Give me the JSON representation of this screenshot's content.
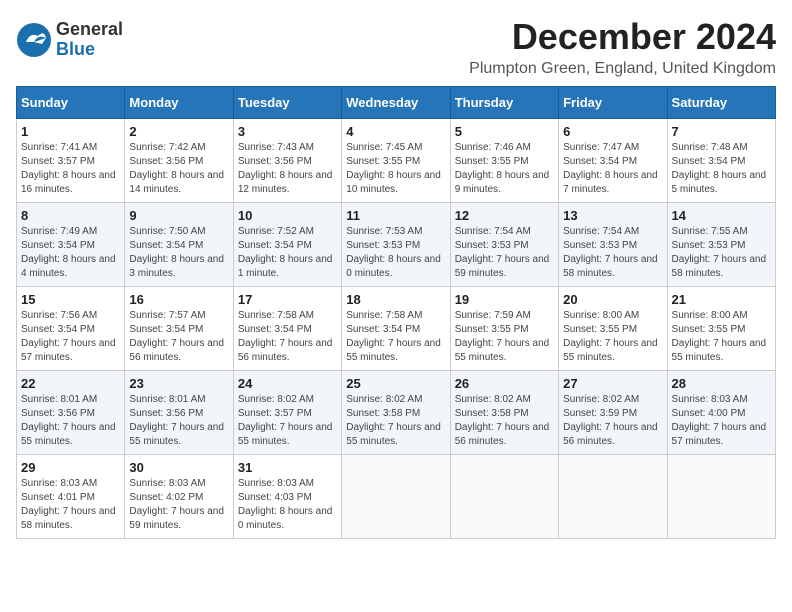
{
  "logo": {
    "line1": "General",
    "line2": "Blue"
  },
  "header": {
    "month_title": "December 2024",
    "subtitle": "Plumpton Green, England, United Kingdom"
  },
  "weekdays": [
    "Sunday",
    "Monday",
    "Tuesday",
    "Wednesday",
    "Thursday",
    "Friday",
    "Saturday"
  ],
  "weeks": [
    [
      {
        "day": "1",
        "rise": "Sunrise: 7:41 AM",
        "set": "Sunset: 3:57 PM",
        "light": "Daylight: 8 hours and 16 minutes."
      },
      {
        "day": "2",
        "rise": "Sunrise: 7:42 AM",
        "set": "Sunset: 3:56 PM",
        "light": "Daylight: 8 hours and 14 minutes."
      },
      {
        "day": "3",
        "rise": "Sunrise: 7:43 AM",
        "set": "Sunset: 3:56 PM",
        "light": "Daylight: 8 hours and 12 minutes."
      },
      {
        "day": "4",
        "rise": "Sunrise: 7:45 AM",
        "set": "Sunset: 3:55 PM",
        "light": "Daylight: 8 hours and 10 minutes."
      },
      {
        "day": "5",
        "rise": "Sunrise: 7:46 AM",
        "set": "Sunset: 3:55 PM",
        "light": "Daylight: 8 hours and 9 minutes."
      },
      {
        "day": "6",
        "rise": "Sunrise: 7:47 AM",
        "set": "Sunset: 3:54 PM",
        "light": "Daylight: 8 hours and 7 minutes."
      },
      {
        "day": "7",
        "rise": "Sunrise: 7:48 AM",
        "set": "Sunset: 3:54 PM",
        "light": "Daylight: 8 hours and 5 minutes."
      }
    ],
    [
      {
        "day": "8",
        "rise": "Sunrise: 7:49 AM",
        "set": "Sunset: 3:54 PM",
        "light": "Daylight: 8 hours and 4 minutes."
      },
      {
        "day": "9",
        "rise": "Sunrise: 7:50 AM",
        "set": "Sunset: 3:54 PM",
        "light": "Daylight: 8 hours and 3 minutes."
      },
      {
        "day": "10",
        "rise": "Sunrise: 7:52 AM",
        "set": "Sunset: 3:54 PM",
        "light": "Daylight: 8 hours and 1 minute."
      },
      {
        "day": "11",
        "rise": "Sunrise: 7:53 AM",
        "set": "Sunset: 3:53 PM",
        "light": "Daylight: 8 hours and 0 minutes."
      },
      {
        "day": "12",
        "rise": "Sunrise: 7:54 AM",
        "set": "Sunset: 3:53 PM",
        "light": "Daylight: 7 hours and 59 minutes."
      },
      {
        "day": "13",
        "rise": "Sunrise: 7:54 AM",
        "set": "Sunset: 3:53 PM",
        "light": "Daylight: 7 hours and 58 minutes."
      },
      {
        "day": "14",
        "rise": "Sunrise: 7:55 AM",
        "set": "Sunset: 3:53 PM",
        "light": "Daylight: 7 hours and 58 minutes."
      }
    ],
    [
      {
        "day": "15",
        "rise": "Sunrise: 7:56 AM",
        "set": "Sunset: 3:54 PM",
        "light": "Daylight: 7 hours and 57 minutes."
      },
      {
        "day": "16",
        "rise": "Sunrise: 7:57 AM",
        "set": "Sunset: 3:54 PM",
        "light": "Daylight: 7 hours and 56 minutes."
      },
      {
        "day": "17",
        "rise": "Sunrise: 7:58 AM",
        "set": "Sunset: 3:54 PM",
        "light": "Daylight: 7 hours and 56 minutes."
      },
      {
        "day": "18",
        "rise": "Sunrise: 7:58 AM",
        "set": "Sunset: 3:54 PM",
        "light": "Daylight: 7 hours and 55 minutes."
      },
      {
        "day": "19",
        "rise": "Sunrise: 7:59 AM",
        "set": "Sunset: 3:55 PM",
        "light": "Daylight: 7 hours and 55 minutes."
      },
      {
        "day": "20",
        "rise": "Sunrise: 8:00 AM",
        "set": "Sunset: 3:55 PM",
        "light": "Daylight: 7 hours and 55 minutes."
      },
      {
        "day": "21",
        "rise": "Sunrise: 8:00 AM",
        "set": "Sunset: 3:55 PM",
        "light": "Daylight: 7 hours and 55 minutes."
      }
    ],
    [
      {
        "day": "22",
        "rise": "Sunrise: 8:01 AM",
        "set": "Sunset: 3:56 PM",
        "light": "Daylight: 7 hours and 55 minutes."
      },
      {
        "day": "23",
        "rise": "Sunrise: 8:01 AM",
        "set": "Sunset: 3:56 PM",
        "light": "Daylight: 7 hours and 55 minutes."
      },
      {
        "day": "24",
        "rise": "Sunrise: 8:02 AM",
        "set": "Sunset: 3:57 PM",
        "light": "Daylight: 7 hours and 55 minutes."
      },
      {
        "day": "25",
        "rise": "Sunrise: 8:02 AM",
        "set": "Sunset: 3:58 PM",
        "light": "Daylight: 7 hours and 55 minutes."
      },
      {
        "day": "26",
        "rise": "Sunrise: 8:02 AM",
        "set": "Sunset: 3:58 PM",
        "light": "Daylight: 7 hours and 56 minutes."
      },
      {
        "day": "27",
        "rise": "Sunrise: 8:02 AM",
        "set": "Sunset: 3:59 PM",
        "light": "Daylight: 7 hours and 56 minutes."
      },
      {
        "day": "28",
        "rise": "Sunrise: 8:03 AM",
        "set": "Sunset: 4:00 PM",
        "light": "Daylight: 7 hours and 57 minutes."
      }
    ],
    [
      {
        "day": "29",
        "rise": "Sunrise: 8:03 AM",
        "set": "Sunset: 4:01 PM",
        "light": "Daylight: 7 hours and 58 minutes."
      },
      {
        "day": "30",
        "rise": "Sunrise: 8:03 AM",
        "set": "Sunset: 4:02 PM",
        "light": "Daylight: 7 hours and 59 minutes."
      },
      {
        "day": "31",
        "rise": "Sunrise: 8:03 AM",
        "set": "Sunset: 4:03 PM",
        "light": "Daylight: 8 hours and 0 minutes."
      },
      null,
      null,
      null,
      null
    ]
  ]
}
